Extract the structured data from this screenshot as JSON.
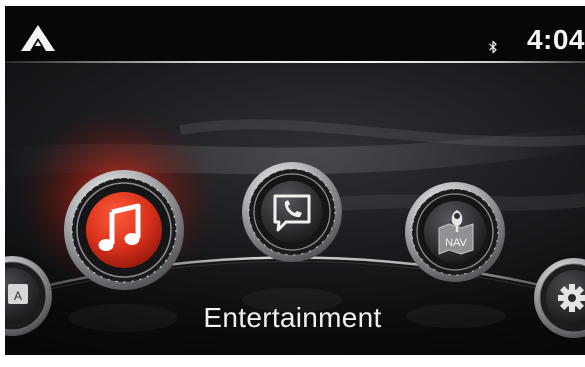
{
  "status_bar": {
    "time": "4:04",
    "bluetooth_icon": "bluetooth-icon",
    "home_icon": "app-launcher-icon"
  },
  "menu": {
    "selected_label": "Entertainment",
    "items": [
      {
        "id": "applications",
        "icon": "applications-icon",
        "icon_text": "A",
        "selected": false
      },
      {
        "id": "entertainment",
        "icon": "music-note-icon",
        "selected": true
      },
      {
        "id": "communication",
        "icon": "phone-message-icon",
        "selected": false
      },
      {
        "id": "navigation",
        "icon": "map-pin-icon",
        "icon_text": "NAV",
        "selected": false
      },
      {
        "id": "settings",
        "icon": "gear-icon",
        "selected": false
      }
    ]
  },
  "colors": {
    "selected_accent": "#d8311c",
    "text": "#f0f0f0",
    "background": "#0b0b0d"
  }
}
